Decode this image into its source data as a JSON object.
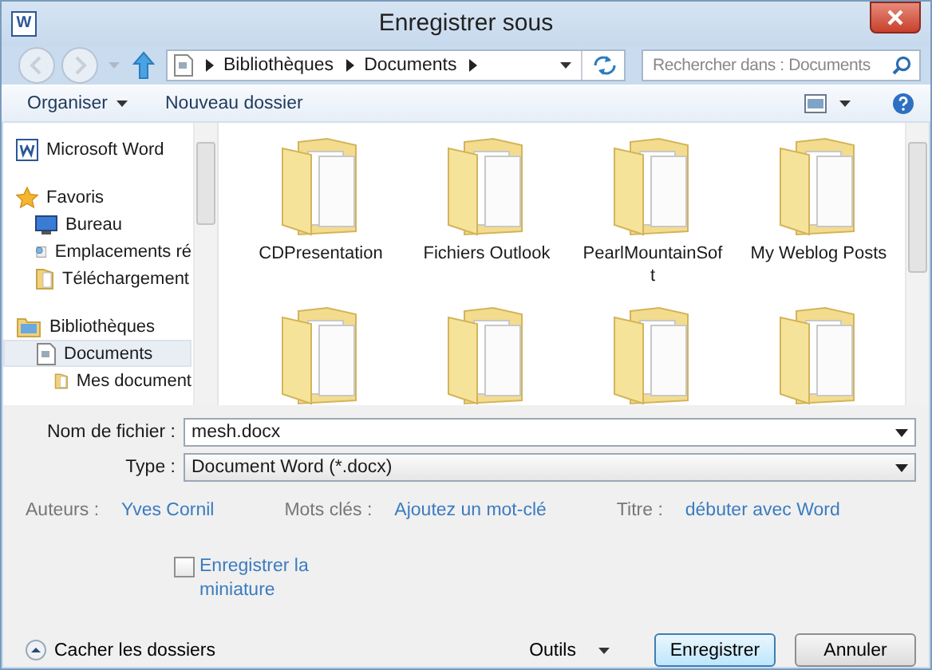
{
  "window": {
    "title": "Enregistrer sous",
    "app_icon_letter": "W"
  },
  "address": {
    "crumbs": [
      "Bibliothèques",
      "Documents"
    ]
  },
  "search": {
    "placeholder": "Rechercher dans : Documents"
  },
  "toolbar": {
    "organize": "Organiser",
    "new_folder": "Nouveau dossier"
  },
  "sidebar": {
    "items": [
      {
        "label": "Microsoft Word",
        "kind": "app",
        "selected": false
      },
      {
        "label": "Favoris",
        "kind": "star",
        "selected": false,
        "children": [
          {
            "label": "Bureau",
            "kind": "desktop",
            "selected": false
          },
          {
            "label": "Emplacements ré",
            "kind": "places",
            "selected": false
          },
          {
            "label": "Téléchargement",
            "kind": "folder",
            "selected": false
          }
        ]
      },
      {
        "label": "Bibliothèques",
        "kind": "library",
        "selected": false,
        "children": [
          {
            "label": "Documents",
            "kind": "document",
            "selected": true,
            "children": [
              {
                "label": "Mes document",
                "kind": "folder",
                "selected": false
              }
            ]
          }
        ]
      }
    ]
  },
  "folders": [
    {
      "kind": "folder",
      "label": "CDPresentation"
    },
    {
      "kind": "folder",
      "label": "Fichiers Outlook"
    },
    {
      "kind": "folder",
      "label": "PearlMountainSoft"
    },
    {
      "kind": "folder",
      "label": "My Weblog Posts"
    },
    {
      "kind": "folder"
    },
    {
      "kind": "folder"
    },
    {
      "kind": "folder"
    },
    {
      "kind": "folder"
    }
  ],
  "form": {
    "filename_label": "Nom de fichier :",
    "filename": "mesh.docx",
    "type_label": "Type :",
    "type": "Document Word (*.docx)"
  },
  "meta": [
    {
      "label": "Auteurs :",
      "value": "Yves Cornil"
    },
    {
      "label": "Mots clés :",
      "value": "Ajoutez un mot-clé"
    },
    {
      "label": "Titre :",
      "value": "débuter avec Word"
    }
  ],
  "thumbnail": {
    "label": "Enregistrer la miniature",
    "checked": false
  },
  "footer": {
    "hide_folders": "Cacher les dossiers",
    "tools": "Outils",
    "save": "Enregistrer",
    "cancel": "Annuler"
  }
}
